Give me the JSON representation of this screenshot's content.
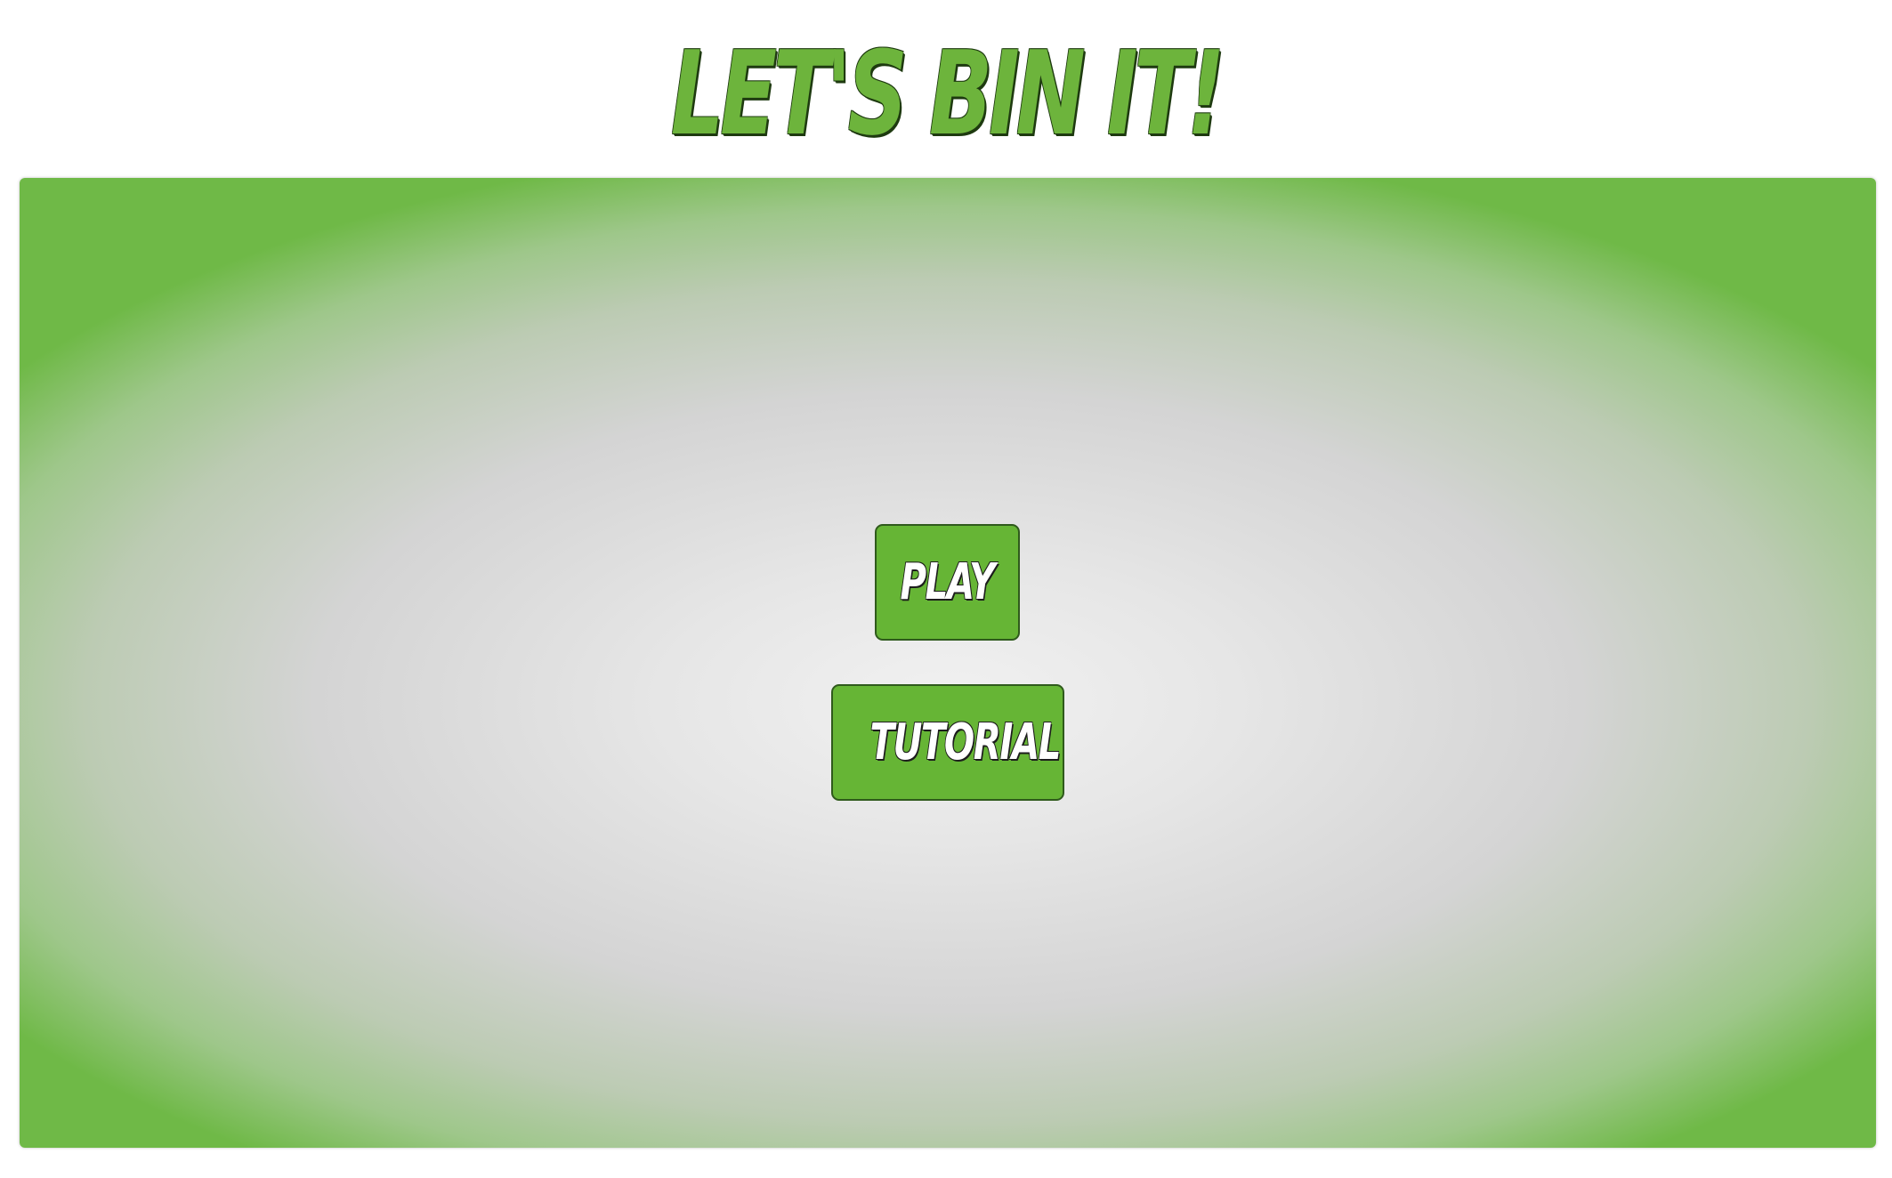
{
  "header": {
    "title": "LET'S BIN IT!"
  },
  "menu": {
    "play_label": "PLAY",
    "tutorial_label": "TUTORIAL"
  },
  "colors": {
    "brand_green": "#6db43c",
    "button_green": "#66b535",
    "button_border": "#2f5a1c",
    "outline": "#1e3a10"
  }
}
